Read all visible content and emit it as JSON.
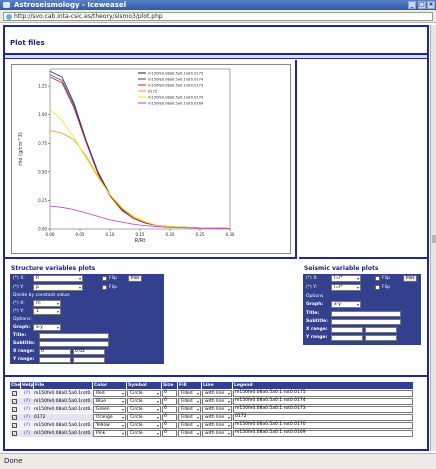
{
  "window": {
    "title": "Astroseismology - Iceweasel"
  },
  "address": {
    "url": "http://svo.cab.inta-csic.es/theory/sismo3/plot.php"
  },
  "page": {
    "heading": "Plot files"
  },
  "chart_data": {
    "type": "line",
    "xlabel": "R/Rt",
    "ylabel": "rho (g/cm^3)",
    "x_ticks": [
      "0.00",
      "0.05",
      "0.10",
      "0.15",
      "0.20",
      "0.25",
      "0.30"
    ],
    "y_ticks": [
      "0.00",
      "0.25",
      "0.50",
      "0.75",
      "1.00",
      "1.25"
    ],
    "xlim": [
      0,
      0.3
    ],
    "ylim": [
      0,
      1.4
    ],
    "grid": false,
    "legend_position": "top-right",
    "series": [
      {
        "name": "m150fe0.08a0.5a0.1rot0.0175",
        "color": "#222222",
        "x": [
          0,
          0.02,
          0.04,
          0.06,
          0.08,
          0.1,
          0.12,
          0.14,
          0.16,
          0.18,
          0.2,
          0.25,
          0.3
        ],
        "y": [
          1.38,
          1.33,
          1.1,
          0.78,
          0.5,
          0.3,
          0.17,
          0.09,
          0.05,
          0.03,
          0.02,
          0.01,
          0.005
        ]
      },
      {
        "name": "m150fe0.08a0.5a0.1rot0.0174",
        "color": "#3040c0",
        "x": [
          0,
          0.02,
          0.04,
          0.06,
          0.08,
          0.1,
          0.12,
          0.14,
          0.16,
          0.18,
          0.2,
          0.25,
          0.3
        ],
        "y": [
          1.35,
          1.3,
          1.08,
          0.77,
          0.49,
          0.29,
          0.17,
          0.09,
          0.05,
          0.03,
          0.02,
          0.01,
          0.005
        ]
      },
      {
        "name": "m150fe0.08a0.5a0.1rot0.0173",
        "color": "#d02020",
        "x": [
          0,
          0.02,
          0.04,
          0.06,
          0.08,
          0.1,
          0.12,
          0.14,
          0.16,
          0.18,
          0.2,
          0.25,
          0.3
        ],
        "y": [
          1.33,
          1.28,
          1.06,
          0.76,
          0.48,
          0.29,
          0.16,
          0.09,
          0.05,
          0.03,
          0.02,
          0.01,
          0.005
        ]
      },
      {
        "name": "0172",
        "color": "#e0a020",
        "x": [
          0,
          0.02,
          0.04,
          0.06,
          0.08,
          0.1,
          0.12,
          0.14,
          0.16,
          0.18,
          0.2,
          0.25,
          0.3
        ],
        "y": [
          0.86,
          0.84,
          0.78,
          0.64,
          0.46,
          0.3,
          0.18,
          0.1,
          0.06,
          0.03,
          0.02,
          0.01,
          0.005
        ]
      },
      {
        "name": "m150fe0.08a0.5a0.1rot0.0170",
        "color": "#e8e820",
        "x": [
          0,
          0.02,
          0.04,
          0.06,
          0.08,
          0.1,
          0.12,
          0.14,
          0.16,
          0.18,
          0.2,
          0.25,
          0.3
        ],
        "y": [
          1.05,
          0.95,
          0.8,
          0.62,
          0.45,
          0.3,
          0.19,
          0.11,
          0.06,
          0.03,
          0.02,
          0.01,
          0.005
        ]
      },
      {
        "name": "m150fe0.08a0.5a0.1rot0.0169",
        "color": "#c040c0",
        "x": [
          0,
          0.02,
          0.04,
          0.06,
          0.08,
          0.1,
          0.12,
          0.14,
          0.16,
          0.18,
          0.2,
          0.25,
          0.3
        ],
        "y": [
          0.2,
          0.19,
          0.17,
          0.14,
          0.11,
          0.08,
          0.06,
          0.04,
          0.03,
          0.02,
          0.015,
          0.008,
          0.004
        ]
      }
    ]
  },
  "structure": {
    "title": "Structure variables plots",
    "x_label": "(*) X:",
    "x_value": "R",
    "y_label": "(*) Y:",
    "y_value": "p",
    "flip_label": "Flip",
    "plot_button": "Plot",
    "divide_label": "Divide by constant value:",
    "dx_label": "(*) X:",
    "dx_value": "rn",
    "dy_label": "(*) Y:",
    "dy_value": "1",
    "options_label": "Options:",
    "graph_label": "Graph:",
    "graph_value": "x-y",
    "title_label": "Title:",
    "subtitle_label": "Subtitle:",
    "xrange_label": "X range:",
    "xrange_min": "0",
    "xrange_max": "0.02",
    "yrange_label": "Y range:"
  },
  "seismic": {
    "title": "Seismic variable plots",
    "x_label": "(*) X:",
    "x_value": "l=l*",
    "y_label": "(*) Y:",
    "y_value": "l=l*",
    "flip_label": "Flip",
    "plot_button": "Plot",
    "options_label": "Options",
    "graph_label": "Graph:",
    "graph_value": "x-y",
    "title_label": "Title:",
    "subtitle_label": "Subtitle:",
    "xrange_label": "X range:",
    "yrange_label": "Y range:"
  },
  "files_table": {
    "headers": [
      "Check",
      "Help",
      "File",
      "Color",
      "Symbol",
      "Size",
      "Fill",
      "Line",
      "Legend"
    ],
    "rows": [
      {
        "help": "(?)",
        "file": "m150fe0.08a0.5a0.1rot0.0175",
        "color": "Red",
        "symbol": "Circle",
        "size": "6",
        "fill": "Filled",
        "line": "with line",
        "legend": "m150fe0.08a0.5a0.1.rot0.0175"
      },
      {
        "help": "(?)",
        "file": "m150fe0.08a0.5a0.1rot0.0174",
        "color": "Blue",
        "symbol": "Circle",
        "size": "6",
        "fill": "Filled",
        "line": "with line",
        "legend": "m150fe0.08a0.5a0.1.rot0.0174"
      },
      {
        "help": "(?)",
        "file": "m150fe0.08a0.5a0.1rot0.0173",
        "color": "Green",
        "symbol": "Circle",
        "size": "6",
        "fill": "Filled",
        "line": "with line",
        "legend": "m150fe0.08a0.5a0.1.rot0.0173"
      },
      {
        "help": "(?)",
        "file": "0172",
        "color": "Orange",
        "symbol": "Circle",
        "size": "6",
        "fill": "Filled",
        "line": "with line",
        "legend": "0172"
      },
      {
        "help": "(?)",
        "file": "m150fe0.08a0.5a0.1rot0.0170",
        "color": "Yellow",
        "symbol": "Circle",
        "size": "6",
        "fill": "Filled",
        "line": "with line",
        "legend": "m150fe0.08a0.5a0.1.rot0.0170"
      },
      {
        "help": "(?)",
        "file": "m150fe0.08a0.5a0.1rot0.0169",
        "color": "Pink",
        "symbol": "Circle",
        "size": "6",
        "fill": "Filled",
        "line": "with line",
        "legend": "m150fe0.08a0.5a0.1.rot0.0169"
      }
    ]
  },
  "status": {
    "text": "Done"
  }
}
